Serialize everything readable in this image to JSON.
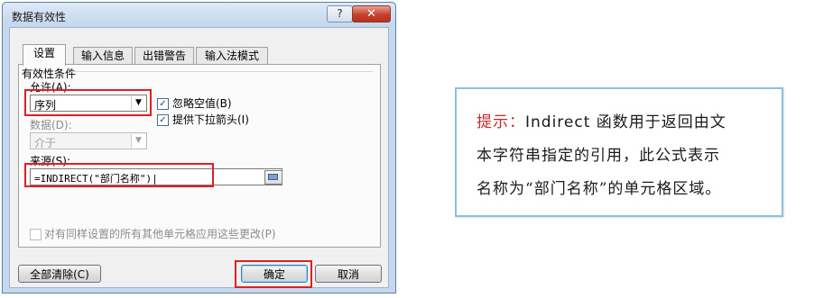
{
  "dialog": {
    "title": "数据有效性",
    "help_glyph": "?",
    "close_glyph": "✕",
    "tabs": [
      {
        "label": "设置",
        "active": true
      },
      {
        "label": "输入信息",
        "active": false
      },
      {
        "label": "出错警告",
        "active": false
      },
      {
        "label": "输入法模式",
        "active": false
      }
    ],
    "settings": {
      "group_label": "有效性条件",
      "allow_label": "允许(A):",
      "allow_value": "序列",
      "ignore_blank_label": "忽略空值(B)",
      "ignore_blank_checked": true,
      "dropdown_label": "提供下拉箭头(I)",
      "dropdown_checked": true,
      "data_label": "数据(D):",
      "data_value": "介于",
      "source_label": "来源(S):",
      "source_value": "=INDIRECT(\"部门名称\")|",
      "apply_all_label": "对有同样设置的所有其他单元格应用这些更改(P)",
      "apply_all_checked": false,
      "check_glyph": "✓",
      "drop_glyph": "▼"
    },
    "buttons": {
      "clear_all": "全部清除(C)",
      "ok": "确定",
      "cancel": "取消"
    },
    "highlight_color": "#e02020"
  },
  "note": {
    "label": "提示：",
    "line1_en": "Indirect",
    "line1_rest": " 函数用于返回由文",
    "line2": "本字符串指定的引用，此公式表示",
    "line3": "名称为“部门名称”的单元格区域。",
    "label_color": "#d0262a",
    "border_color": "#8fbfe0"
  }
}
